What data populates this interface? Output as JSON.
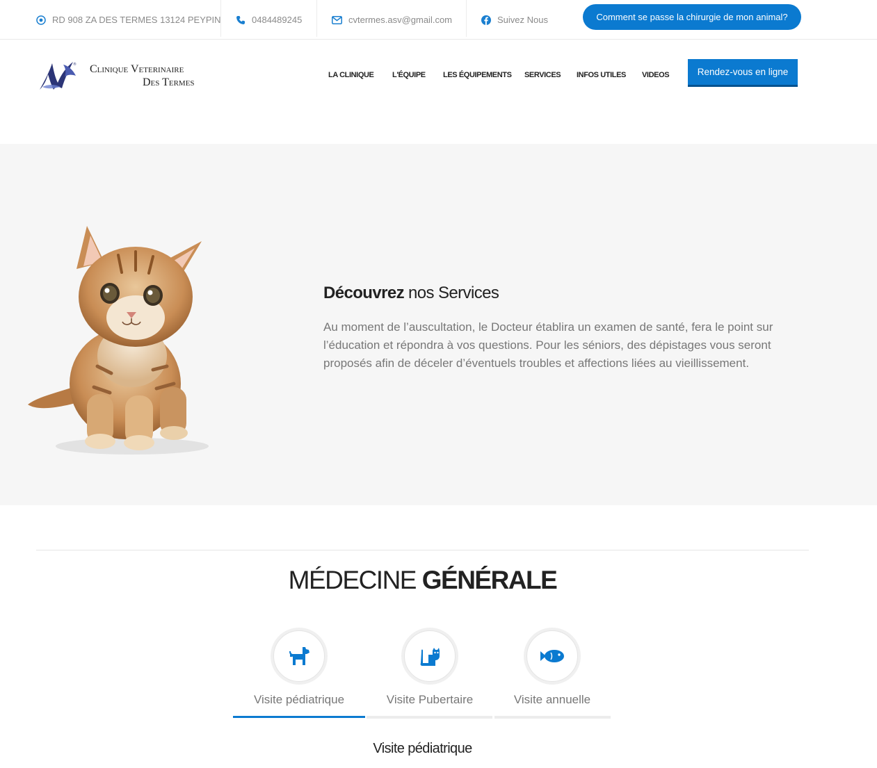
{
  "topbar": {
    "address": "RD 908 ZA DES TERMES 13124 PEYPIN",
    "phone": "0484489245",
    "email": "cvtermes.asv@gmail.com",
    "social": "Suivez Nous",
    "cta": "Comment se passe la chirurgie de mon animal?"
  },
  "logo": {
    "line1": "Clinique Veterinaire",
    "line2": "Des Termes"
  },
  "nav": {
    "items": [
      "LA CLINIQUE",
      "L'ÉQUIPE",
      "LES ÉQUIPEMENTS",
      "SERVICES",
      "INFOS UTILES",
      "VIDEOS"
    ],
    "rdv": "Rendez-vous en ligne"
  },
  "hero": {
    "title_bold": "Découvrez",
    "title_rest": " nos Services",
    "text": "Au moment de l’auscultation, le Docteur établira un examen de santé, fera le point sur l’éducation et répondra à vos questions. Pour les séniors, des dépistages vous seront proposés afin de déceler d’éventuels troubles et affections liées au vieillissement."
  },
  "section": {
    "title_light": "MÉDECINE ",
    "title_bold": "GÉNÉRALE",
    "tabs": [
      {
        "label": "Visite pédiatrique",
        "icon": "dog-icon"
      },
      {
        "label": "Visite Pubertaire",
        "icon": "cat-icon"
      },
      {
        "label": "Visite annuelle",
        "icon": "fish-icon"
      }
    ],
    "active_tab": 0,
    "panel_title": "Visite pédiatrique"
  },
  "colors": {
    "accent": "#0b7ad0",
    "hero_bg": "#f6f6f6",
    "text_muted": "#777777"
  }
}
